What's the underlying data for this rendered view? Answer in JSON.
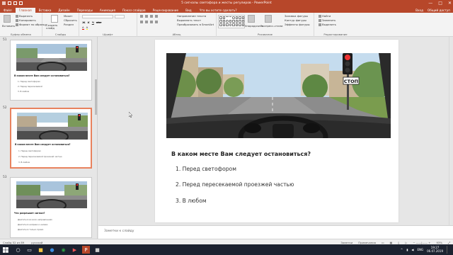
{
  "window": {
    "title": "5 сигналы светофора и жесты регулиров - PowerPoint",
    "controls": [
      "—",
      "□",
      "✕"
    ]
  },
  "tabs": {
    "file": "Файл",
    "items": [
      "Главная",
      "Вставка",
      "Дизайн",
      "Переходы",
      "Анимация",
      "Показ слайдов",
      "Рецензирование",
      "Вид"
    ],
    "tell_me": "Что вы хотите сделать?",
    "right": [
      "Вход",
      "Общий доступ"
    ]
  },
  "ribbon": {
    "clipboard": {
      "label": "Буфер обмена",
      "paste": "Вставить",
      "cut": "Вырезать",
      "copy": "Копировать",
      "format": "Формат по образцу"
    },
    "slides": {
      "label": "Слайды",
      "new": "Создать слайд",
      "layout": "Макет",
      "reset": "Сбросить",
      "section": "Раздел"
    },
    "font": {
      "label": "Шрифт"
    },
    "paragraph": {
      "label": "Абзац",
      "direction": "Направление текста",
      "align": "Выровнять текст",
      "smartart": "Преобразовать в SmartArt"
    },
    "drawing": {
      "label": "Рисование",
      "arrange": "Упорядочить",
      "styles": "Экспресс-стили",
      "fill": "Заливка фигуры",
      "outline": "Контур фигуры",
      "effects": "Эффекты фигуры"
    },
    "editing": {
      "label": "Редактирование",
      "find": "Найти",
      "replace": "Заменить",
      "select": "Выделить"
    }
  },
  "thumbnails": [
    {
      "num": "51",
      "question": "В каком месте Вам следует остановиться?",
      "options": [
        "1. Перед светофором",
        "2. Перед пересекаемой",
        "3. В любом"
      ],
      "selected": false
    },
    {
      "num": "52",
      "question": "В каком месте Вам следует остановиться?",
      "options": [
        "1. Перед светофором",
        "2. Перед пересекаемой проезжей частью",
        "3. В любом"
      ],
      "selected": true
    },
    {
      "num": "53",
      "question": "Что разрешает сигнал?",
      "options": [
        "Двигаться во всех направлениях",
        "Двигаться направо и налево",
        "Двигаться только прямо"
      ],
      "selected": false
    }
  ],
  "slide": {
    "sign_text": "СТОП",
    "question": "В каком месте Вам следует остановиться?",
    "options": [
      "1. Перед светофором",
      "2. Перед пересекаемой проезжей частью",
      "3. В любом"
    ]
  },
  "notes": {
    "placeholder": "Заметки к слайду"
  },
  "status": {
    "slide_info": "Слайд 52 из 89",
    "language": "русский",
    "notes_btn": "Заметки",
    "comments_btn": "Примечания",
    "zoom": "93%"
  },
  "taskbar": {
    "clock_time": "19:27",
    "clock_date": "06.07.2019",
    "lang": "ENG"
  },
  "colors": {
    "accent": "#b7472a",
    "selection": "#e8825e",
    "taskbar": "#1c2230"
  }
}
